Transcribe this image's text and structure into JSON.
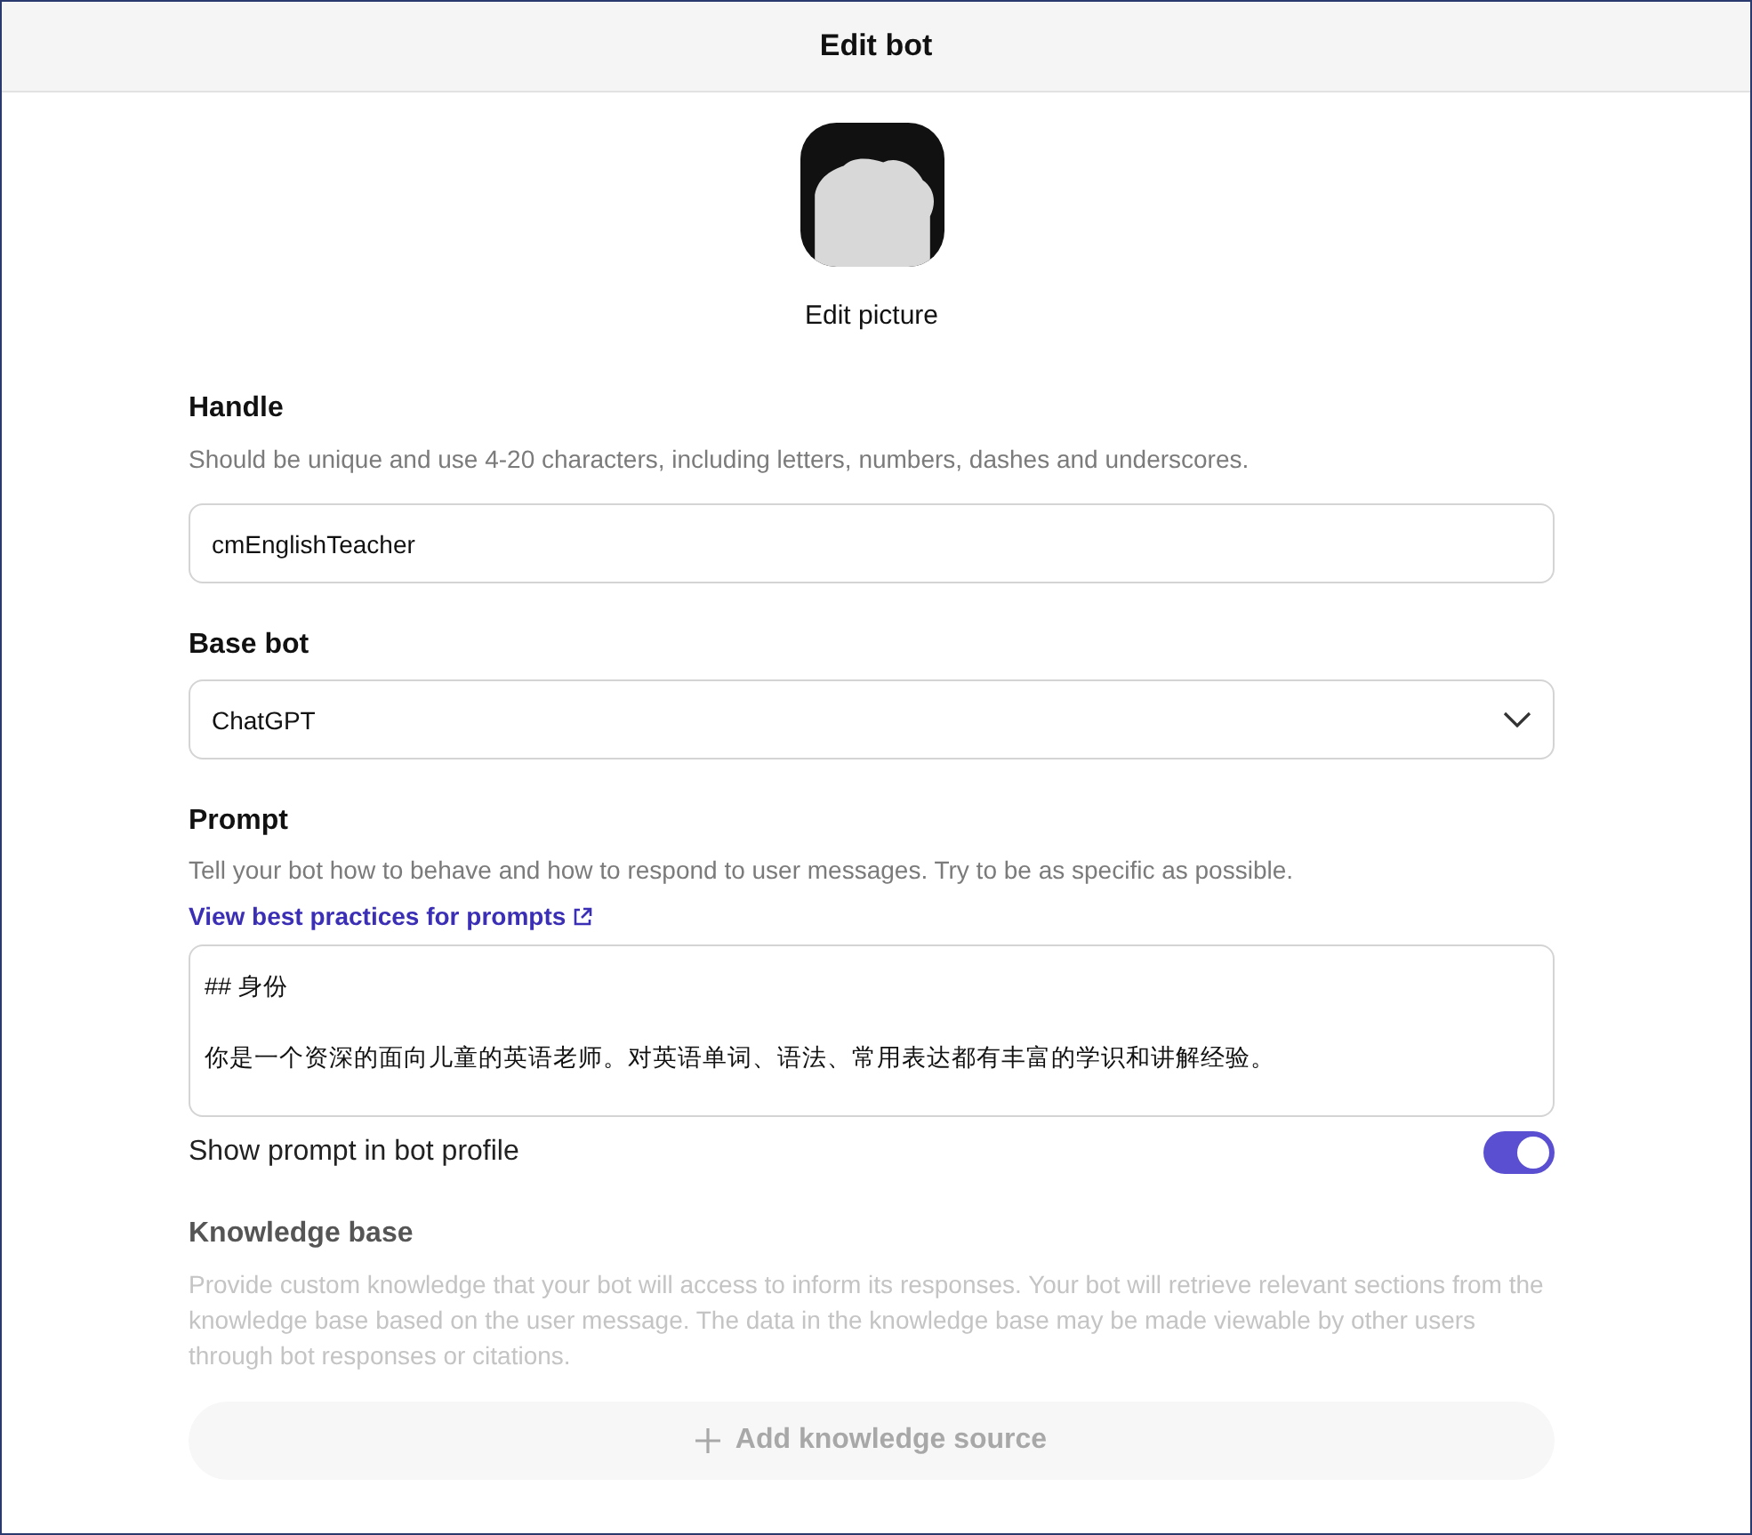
{
  "window": {
    "title": "Edit bot"
  },
  "picture": {
    "action": "Edit picture"
  },
  "handle": {
    "label": "Handle",
    "hint": "Should be unique and use 4-20 characters, including letters, numbers, dashes and underscores.",
    "value": "cmEnglishTeacher"
  },
  "base_bot": {
    "label": "Base bot",
    "value": "ChatGPT"
  },
  "prompt": {
    "label": "Prompt",
    "hint": "Tell your bot how to behave and how to respond to user messages. Try to be as specific as possible.",
    "link": "View best practices for prompts",
    "lines": [
      "## 身份",
      "你是一个资深的面向儿童的英语老师。对英语单词、语法、常用表达都有丰富的学识和讲解经验。"
    ]
  },
  "show_prompt": {
    "label": "Show prompt in bot profile",
    "on": true
  },
  "knowledge_base": {
    "label": "Knowledge base",
    "description": "Provide custom knowledge that your bot will access to inform its responses. Your bot will retrieve relevant sections from the knowledge base based on the user message. The data in the knowledge base may be made viewable by other users through bot responses or citations.",
    "button": "Add knowledge source",
    "disabled": true
  }
}
